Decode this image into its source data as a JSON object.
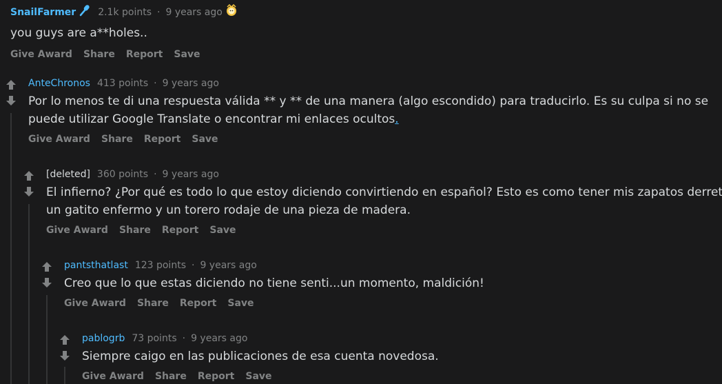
{
  "comments": [
    {
      "author": "SnailFarmer",
      "points": "2.1k points",
      "time": "9 years ago",
      "body": "you guys are a**holes..",
      "actions": [
        "Give Award",
        "Share",
        "Report",
        "Save"
      ]
    },
    {
      "author": "AnteChronos",
      "points": "413 points",
      "time": "9 years ago",
      "body_line1": "Por lo menos te di una respuesta válida ** y ** de una manera (algo escondido) para traducirlo. Es su culpa si no se",
      "body_line2": "puede utilizar Google Translate o encontrar mi enlaces ocultos",
      "body_link": ".",
      "actions": [
        "Give Award",
        "Share",
        "Report",
        "Save"
      ]
    },
    {
      "author": "[deleted]",
      "points": "360 points",
      "time": "9 years ago",
      "body_line1": "El infierno? ¿Por qué es todo lo que estoy diciendo convirtiendo en español? Esto es como tener mis zapatos derretir en",
      "body_line2": "un gatito enfermo y un torero rodaje de una pieza de madera.",
      "actions": [
        "Give Award",
        "Share",
        "Report",
        "Save"
      ]
    },
    {
      "author": "pantsthatlast",
      "points": "123 points",
      "time": "9 years ago",
      "body": "Creo que lo que estas diciendo no tiene senti...un momento, maldición!",
      "actions": [
        "Give Award",
        "Share",
        "Report",
        "Save"
      ]
    },
    {
      "author": "pablogrb",
      "points": "73 points",
      "time": "9 years ago",
      "body": "Siempre caigo en las publicaciones de esa cuenta novedosa.",
      "actions": [
        "Give Award",
        "Share",
        "Report",
        "Save"
      ]
    }
  ],
  "separator": "·",
  "colors": {
    "background": "#1a1a1b",
    "text": "#d7dadc",
    "meta": "#818384",
    "author": "#4fbcff",
    "thread_line": "#343536"
  }
}
